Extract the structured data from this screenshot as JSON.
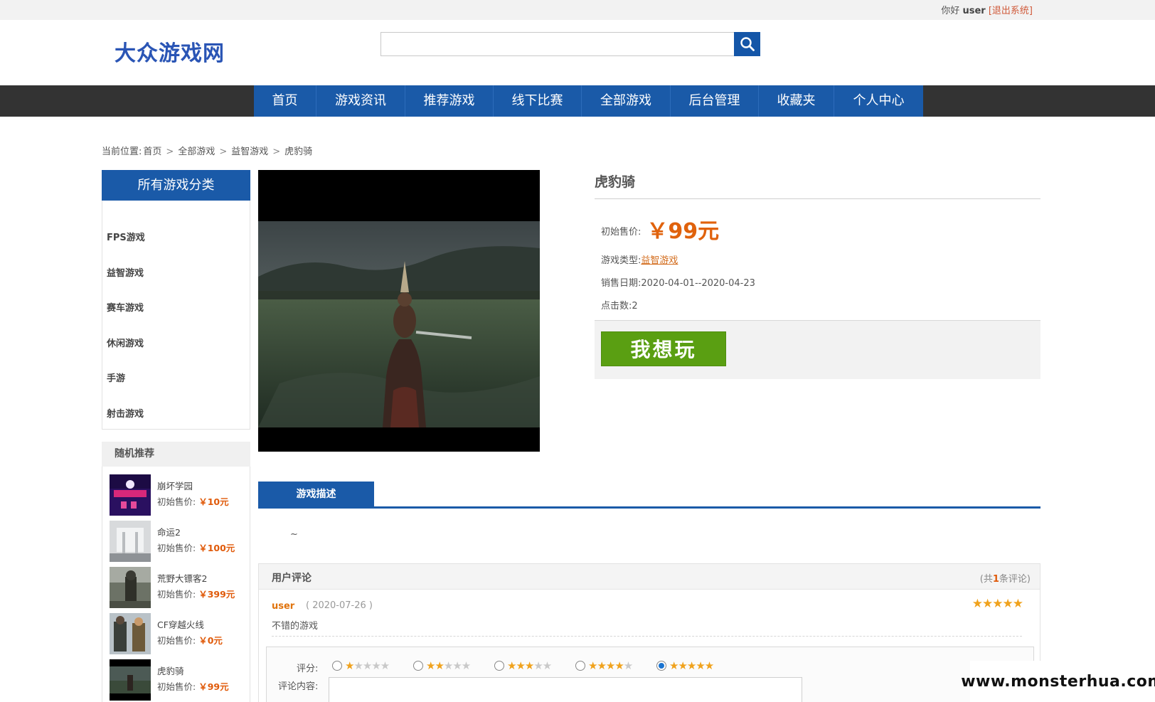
{
  "top_bar": {
    "greeting": "你好",
    "username": "user",
    "logout_label": "[退出系统]"
  },
  "header": {
    "logo_text": "大众游戏网",
    "search": {
      "value": "",
      "placeholder": ""
    }
  },
  "nav": {
    "items": [
      {
        "label": "首页"
      },
      {
        "label": "游戏资讯"
      },
      {
        "label": "推荐游戏"
      },
      {
        "label": "线下比赛"
      },
      {
        "label": "全部游戏"
      },
      {
        "label": "后台管理"
      },
      {
        "label": "收藏夹"
      },
      {
        "label": "个人中心"
      }
    ]
  },
  "breadcrumb": {
    "prefix": "当前位置:",
    "items": [
      "首页",
      "全部游戏",
      "益智游戏",
      "虎豹骑"
    ],
    "separator": ">"
  },
  "sidebar": {
    "category_title": "所有游戏分类",
    "categories": [
      "FPS游戏",
      "益智游戏",
      "赛车游戏",
      "休闲游戏",
      "手游",
      "射击游戏"
    ],
    "recommend_title": "随机推荐",
    "price_label": "初始售价:",
    "recommendations": [
      {
        "name": "崩坏学园",
        "price": "￥10元"
      },
      {
        "name": "命运2",
        "price": "￥100元"
      },
      {
        "name": "荒野大镖客2",
        "price": "￥399元"
      },
      {
        "name": "CF穿越火线",
        "price": "￥0元"
      },
      {
        "name": "虎豹骑",
        "price": "￥99元"
      }
    ]
  },
  "game": {
    "title": "虎豹骑",
    "price_label": "初始售价:",
    "price": "￥99元",
    "type_label": "游戏类型:",
    "type": "益智游戏",
    "date_label": "销售日期:",
    "date": "2020-04-01--2020-04-23",
    "clicks_label": "点击数:",
    "clicks": "2",
    "buy_label": "我想玩"
  },
  "tabs": {
    "description_tab": "游戏描述",
    "description_text": "~"
  },
  "comments": {
    "title": "用户评论",
    "count_prefix": "(共",
    "count": "1",
    "count_suffix": "条评论)",
    "items": [
      {
        "user": "user",
        "date": "( 2020-07-26 )",
        "rating": 5,
        "stars": "★★★★★",
        "text": "不错的游戏"
      }
    ],
    "form": {
      "rating_label": "评分:",
      "content_label": "评论内容:",
      "options": [
        {
          "value": 1,
          "filled": "★",
          "empty": "★★★★"
        },
        {
          "value": 2,
          "filled": "★★",
          "empty": "★★★"
        },
        {
          "value": 3,
          "filled": "★★★",
          "empty": "★★"
        },
        {
          "value": 4,
          "filled": "★★★★",
          "empty": "★"
        },
        {
          "value": 5,
          "filled": "★★★★★",
          "empty": ""
        }
      ],
      "selected": 5,
      "content_value": ""
    }
  },
  "watermark": "www.monsterhua.com",
  "colors": {
    "accent_blue": "#1a5aa8",
    "price_orange": "#e0620c",
    "buy_green": "#5a9f12",
    "nav_dark": "#333333",
    "star_gold": "#f0a21c"
  }
}
